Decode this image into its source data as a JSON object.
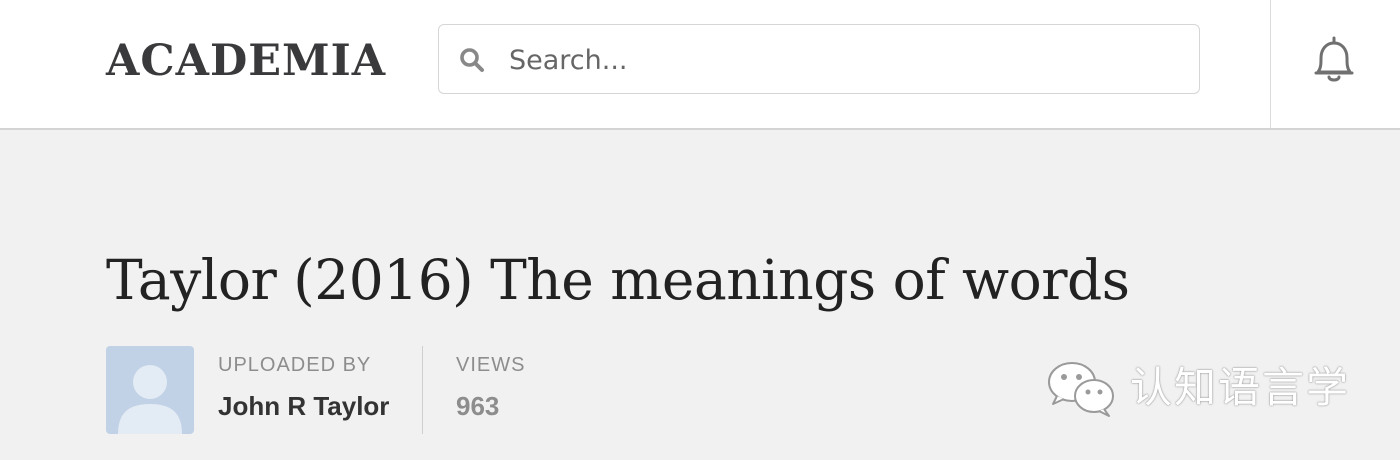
{
  "header": {
    "logo": "ACADEMIA",
    "search": {
      "placeholder": "Search...",
      "value": ""
    },
    "icons": {
      "search": "search-icon",
      "notifications": "bell-icon"
    }
  },
  "document": {
    "title": "Taylor (2016) The meanings of words",
    "uploaded_by_label": "UPLOADED BY",
    "author": "John R Taylor",
    "views_label": "VIEWS",
    "views": "963"
  },
  "watermark": {
    "text": "认知语言学",
    "icon": "wechat-icon"
  },
  "colors": {
    "background": "#f1f1f1",
    "header_bg": "#ffffff",
    "title": "#222222",
    "avatar_bg": "#c1d2e6"
  }
}
